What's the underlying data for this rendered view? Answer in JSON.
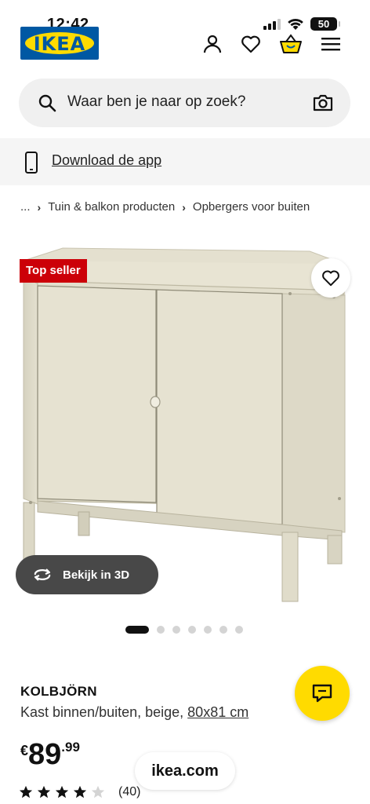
{
  "status_bar": {
    "time": "12:42",
    "battery": "50"
  },
  "header": {
    "logo_text": "IKEA",
    "icons": [
      "user-icon",
      "heart-icon",
      "basket-icon",
      "menu-icon"
    ]
  },
  "search": {
    "placeholder": "Waar ben je naar op zoek?"
  },
  "app_banner": {
    "label": "Download de app"
  },
  "breadcrumb": {
    "items": [
      "...",
      "Tuin & balkon producten",
      "Opbergers voor buiten"
    ]
  },
  "product_image": {
    "badge": "Top seller",
    "view_3d_label": "Bekijk in 3D",
    "carousel": {
      "total": 7,
      "active": 1
    }
  },
  "product": {
    "name": "KOLBJÖRN",
    "description": "Kast binnen/buiten, beige, ",
    "size": "80x81 cm",
    "price": {
      "currency": "€",
      "main": "89",
      "cents": ".99"
    },
    "rating": {
      "stars": 4,
      "max": 5,
      "count": "(40)"
    }
  },
  "browser": {
    "url": "ikea.com"
  },
  "colors": {
    "ikea_blue": "#0058a3",
    "ikea_yellow": "#ffdb00",
    "badge_red": "#cc0008"
  }
}
